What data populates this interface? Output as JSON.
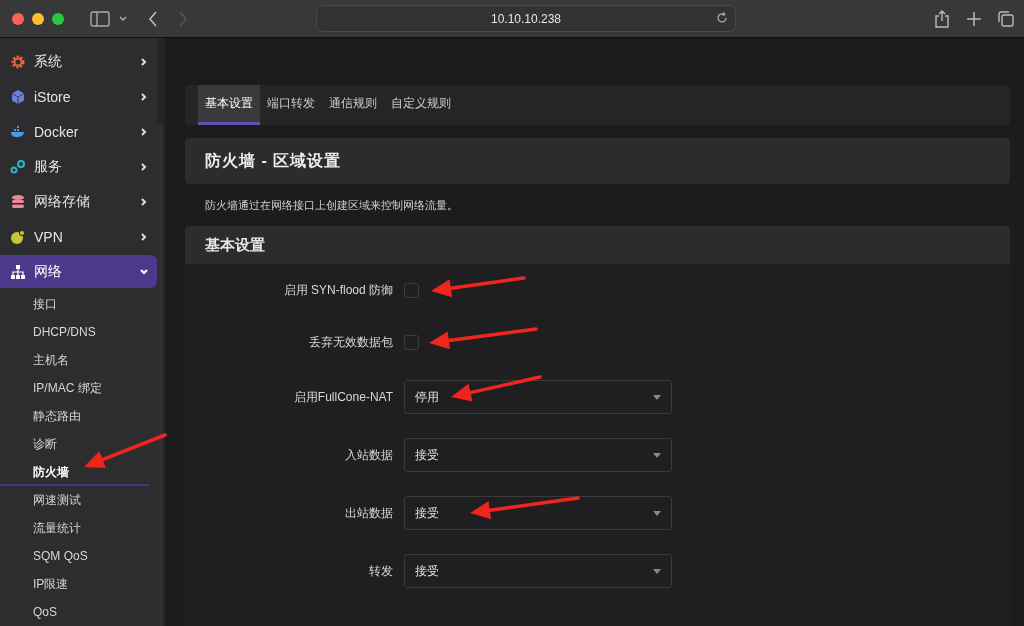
{
  "browser": {
    "url": "10.10.10.238"
  },
  "sidebar": {
    "items": [
      {
        "label": "系统",
        "selected": false,
        "expanded": false
      },
      {
        "label": "iStore",
        "selected": false,
        "expanded": false
      },
      {
        "label": "Docker",
        "selected": false,
        "expanded": false
      },
      {
        "label": "服务",
        "selected": false,
        "expanded": false
      },
      {
        "label": "网络存储",
        "selected": false,
        "expanded": false
      },
      {
        "label": "VPN",
        "selected": false,
        "expanded": false
      },
      {
        "label": "网络",
        "selected": true,
        "expanded": true,
        "children": [
          {
            "label": "接口",
            "selected": false
          },
          {
            "label": "DHCP/DNS",
            "selected": false
          },
          {
            "label": "主机名",
            "selected": false
          },
          {
            "label": "IP/MAC 绑定",
            "selected": false
          },
          {
            "label": "静态路由",
            "selected": false
          },
          {
            "label": "诊断",
            "selected": false
          },
          {
            "label": "防火墙",
            "selected": true
          },
          {
            "label": "网速测试",
            "selected": false
          },
          {
            "label": "流量统计",
            "selected": false
          },
          {
            "label": "SQM QoS",
            "selected": false
          },
          {
            "label": "IP限速",
            "selected": false
          },
          {
            "label": "QoS",
            "selected": false
          }
        ]
      }
    ]
  },
  "tabs": [
    {
      "label": "基本设置",
      "selected": true
    },
    {
      "label": "端口转发",
      "selected": false
    },
    {
      "label": "通信规则",
      "selected": false
    },
    {
      "label": "自定义规则",
      "selected": false
    }
  ],
  "page_title": "防火墙 - 区域设置",
  "description": "防火墙通过在网络接口上创建区域来控制网络流量。",
  "section": {
    "title": "基本设置",
    "fields": [
      {
        "kind": "checkbox",
        "label": "启用 SYN-flood 防御",
        "checked": false
      },
      {
        "kind": "checkbox",
        "label": "丢弃无效数据包",
        "checked": false
      },
      {
        "kind": "select",
        "label": "启用FullCone-NAT",
        "value": "停用"
      },
      {
        "kind": "select",
        "label": "入站数据",
        "value": "接受"
      },
      {
        "kind": "select",
        "label": "出站数据",
        "value": "接受"
      },
      {
        "kind": "select",
        "label": "转发",
        "value": "接受"
      }
    ]
  }
}
